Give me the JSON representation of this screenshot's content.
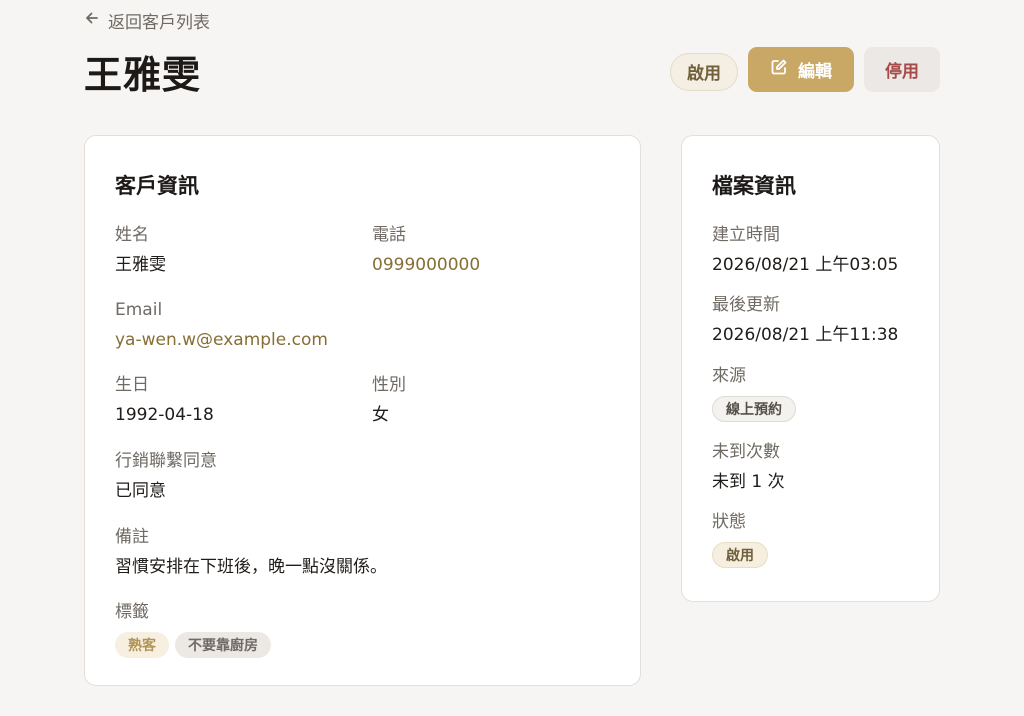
{
  "nav": {
    "back_label": "返回客戶列表"
  },
  "page": {
    "title": "王雅雯"
  },
  "actions": {
    "enable_label": "啟用",
    "edit_label": "編輯",
    "disable_label": "停用"
  },
  "customer_info": {
    "title": "客戶資訊",
    "name": {
      "label": "姓名",
      "value": "王雅雯"
    },
    "phone": {
      "label": "電話",
      "value": "0999000000"
    },
    "email": {
      "label": "Email",
      "value": "ya-wen.w@example.com"
    },
    "birthday": {
      "label": "生日",
      "value": "1992-04-18"
    },
    "gender": {
      "label": "性別",
      "value": "女"
    },
    "marketing": {
      "label": "行銷聯繫同意",
      "value": "已同意"
    },
    "notes": {
      "label": "備註",
      "value": "習慣安排在下班後，晚一點沒關係。"
    },
    "tags": {
      "label": "標籤",
      "items": [
        "熟客",
        "不要靠廚房"
      ]
    }
  },
  "file_info": {
    "title": "檔案資訊",
    "created": {
      "label": "建立時間",
      "value": "2026/08/21 上午03:05"
    },
    "updated": {
      "label": "最後更新",
      "value": "2026/08/21 上午11:38"
    },
    "source": {
      "label": "來源",
      "value": "線上預約"
    },
    "no_show": {
      "label": "未到次數",
      "value": "未到 1 次"
    },
    "status": {
      "label": "狀態",
      "value": "啟用"
    }
  },
  "colors": {
    "accent": "#c9a866",
    "danger": "#a64a4a",
    "link": "#866e35",
    "background": "#f6f5f3"
  },
  "icons": {
    "back": "arrow-left-icon",
    "edit": "edit-icon"
  }
}
